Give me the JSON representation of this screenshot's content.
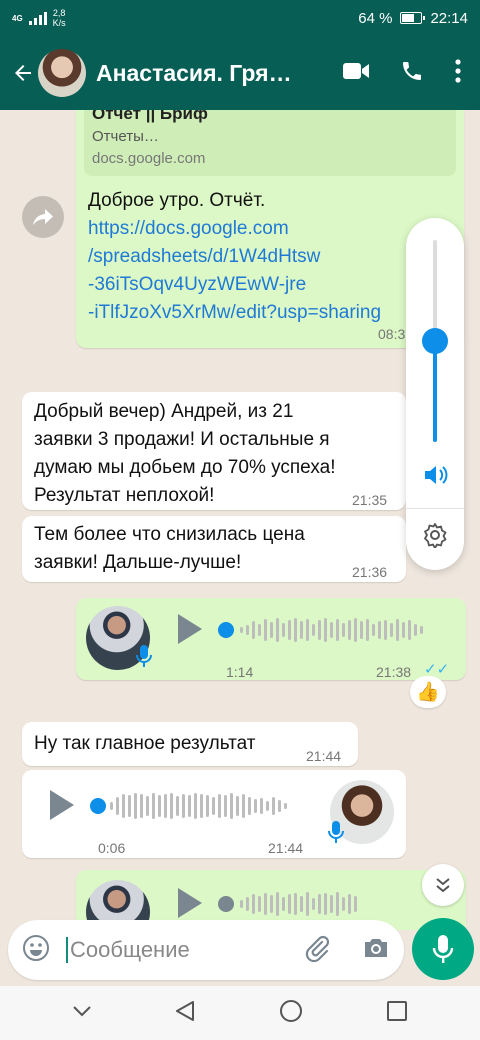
{
  "status_bar": {
    "network": "4G",
    "speed": "2,8",
    "speed_unit": "K/s",
    "battery": "64 %",
    "time": "22:14"
  },
  "header": {
    "contact_name": "Анастасия. Гря…",
    "icons": [
      "back-arrow-icon",
      "video-call-icon",
      "phone-icon",
      "more-vert-icon"
    ]
  },
  "messages": {
    "preview": {
      "title": "Отчет || Бриф",
      "subtitle": "Отчеты…",
      "domain": "docs.google.com"
    },
    "m1": {
      "text": "Доброе утро. Отчёт.",
      "link_lines": [
        "https://docs.google.com",
        "/spreadsheets/d/1W4dHtsw",
        "-36iTsOqv4UyzWEwW-jre",
        "-iTlfJzoXv5XrMw/edit?usp=sharing"
      ],
      "time": "08:3"
    },
    "m2": {
      "lines": [
        "Добрый вечер) Андрей, из 21",
        "заявки 3 продажи! И остальные я",
        "думаю мы добьем до 70% успеха!",
        "Результат неплохой!"
      ],
      "time": "21:35"
    },
    "m3": {
      "lines": [
        "Тем более что снизилась цена",
        "заявки! Дальше-лучше!"
      ],
      "time": "21:36"
    },
    "voice1": {
      "duration": "1:14",
      "time": "21:38",
      "status": "✓✓",
      "reaction": "👍"
    },
    "m4": {
      "text": "Ну так главное результат",
      "time": "21:44"
    },
    "voice2": {
      "duration": "0:06",
      "time": "21:44"
    }
  },
  "volume_panel": {
    "level": 0.5,
    "icons": [
      "speaker-icon",
      "settings-gear-icon"
    ]
  },
  "input": {
    "placeholder": "Сообщение"
  },
  "colors": {
    "header": "#075e54",
    "outgoing": "#dcf8c6",
    "incoming": "#ffffff",
    "accent": "#00a884",
    "link": "#1f7ad6",
    "voice_dot": "#0d8ee8"
  },
  "nav_bar": {
    "icons": [
      "collapse-icon",
      "back-triangle-icon",
      "home-circle-icon",
      "recents-square-icon"
    ]
  }
}
